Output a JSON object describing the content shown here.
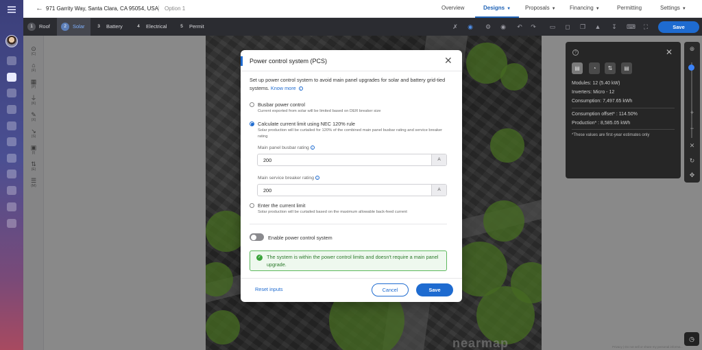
{
  "header": {
    "address": "971 Garrity Way, Santa Clara, CA 95054, USA",
    "option": "Option 1",
    "nav": [
      {
        "label": "Overview",
        "caret": false
      },
      {
        "label": "Designs",
        "caret": true
      },
      {
        "label": "Proposals",
        "caret": true
      },
      {
        "label": "Financing",
        "caret": true
      },
      {
        "label": "Permitting",
        "caret": false
      },
      {
        "label": "Settings",
        "caret": true
      }
    ]
  },
  "toolbar": {
    "steps": [
      {
        "num": "1",
        "label": "Roof"
      },
      {
        "num": "2",
        "label": "Solar"
      },
      {
        "num": "3",
        "label": "Battery"
      },
      {
        "num": "4",
        "label": "Electrical"
      },
      {
        "num": "5",
        "label": "Permit"
      }
    ],
    "save_label": "Save"
  },
  "tools": [
    {
      "icon": "⊙",
      "key": "(C)"
    },
    {
      "icon": "⌂",
      "key": "(F)"
    },
    {
      "icon": "▦",
      "key": "(P)"
    },
    {
      "icon": "⏚",
      "key": "(K)"
    },
    {
      "icon": "✎",
      "key": "(X)"
    },
    {
      "icon": "↘",
      "key": "(S)"
    },
    {
      "icon": "▣",
      "key": "(I)"
    },
    {
      "icon": "⇅",
      "key": "(E)"
    },
    {
      "icon": "☰",
      "key": "(M)"
    }
  ],
  "panel": {
    "modules": "Modules:  12 (5.40 kW)",
    "inverters": "Inverters:  Micro - 12",
    "consumption": "Consumption:  7,497.65 kWh",
    "offset": "Consumption offset* :  114.50%",
    "production": "Production* :  8,585.05 kWh",
    "note": "*These values are first-year estimates only"
  },
  "map": {
    "watermark": "nearmap"
  },
  "footer": "Privacy  |  Do not sell or share my personal informa...",
  "modal": {
    "title": "Power control system (PCS)",
    "description": "Set up power control system to avoid main panel upgrades for solar and battery grid-tied systems.",
    "know_more": "Know more",
    "opt1": {
      "label": "Busbar power control",
      "sub": "Current exported from solar will be limited based on DER breaker size"
    },
    "opt2": {
      "label": "Calculate current limit using NEC 120% rule",
      "sub": "Solar production will be curtailed for 120% of the combined main panel busbar rating and service breaker rating"
    },
    "busbar": {
      "label": "Main panel busbar rating",
      "value": "200",
      "unit": "A"
    },
    "breaker": {
      "label": "Main service breaker rating",
      "value": "200",
      "unit": "A"
    },
    "opt3": {
      "label": "Enter the current limit",
      "sub": "Solar production will be curtailed based on the maximum allowable back-feed current"
    },
    "toggle_label": "Enable power control system",
    "success": "The system is within the power control limits and doesn't require a main panel upgrade.",
    "reset": "Reset inputs",
    "cancel": "Cancel",
    "save": "Save"
  }
}
